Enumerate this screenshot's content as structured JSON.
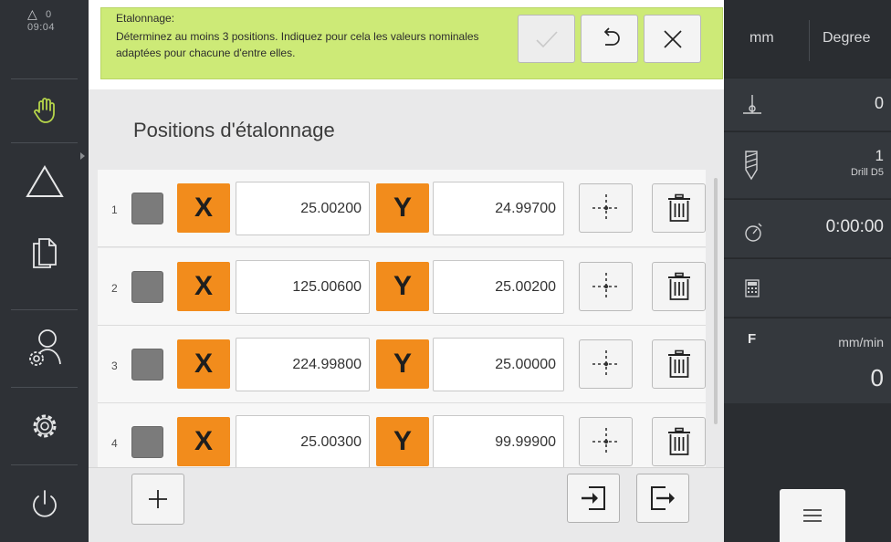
{
  "status": {
    "warnings_count": "0",
    "time": "09:04"
  },
  "sidebar": {
    "items": [
      {
        "name": "manual-mode",
        "icon": "hand-icon"
      },
      {
        "name": "measure",
        "icon": "triangle-icon"
      },
      {
        "name": "files",
        "icon": "document-icon"
      },
      {
        "name": "user",
        "icon": "user-settings-icon"
      },
      {
        "name": "settings",
        "icon": "gear-icon"
      },
      {
        "name": "power",
        "icon": "power-icon"
      }
    ]
  },
  "instruction": {
    "title": "Etalonnage:",
    "message": "Déterminez au moins 3 positions. Indiquez pour cela les valeurs nominales adaptées pour chacune d'entre elles.",
    "confirm_icon": "check-icon",
    "undo_icon": "undo-icon",
    "cancel_icon": "close-icon"
  },
  "main": {
    "title": "Positions d'étalonnage",
    "axis_x": "X",
    "axis_y": "Y",
    "rows": [
      {
        "num": "1",
        "x": "25.00200",
        "y": "24.99700"
      },
      {
        "num": "2",
        "x": "125.00600",
        "y": "25.00200"
      },
      {
        "num": "3",
        "x": "224.99800",
        "y": "25.00000"
      },
      {
        "num": "4",
        "x": "25.00300",
        "y": "99.99900"
      }
    ]
  },
  "bottom": {
    "add_icon": "plus-icon",
    "import_icon": "import-icon",
    "export_icon": "export-icon"
  },
  "right_panel": {
    "unit_linear": "mm",
    "unit_angle": "Degree",
    "datum_value": "0",
    "tool_number": "1",
    "tool_name": "Drill D5",
    "timer": "0:00:00",
    "feed_label": "F",
    "feed_unit": "mm/min",
    "feed_value": "0"
  },
  "colors": {
    "instruction_bg": "#cdea77",
    "axis_bg": "#f28c1c",
    "sidebar_bg": "#2e3136",
    "right_bg": "#2a2d31"
  }
}
